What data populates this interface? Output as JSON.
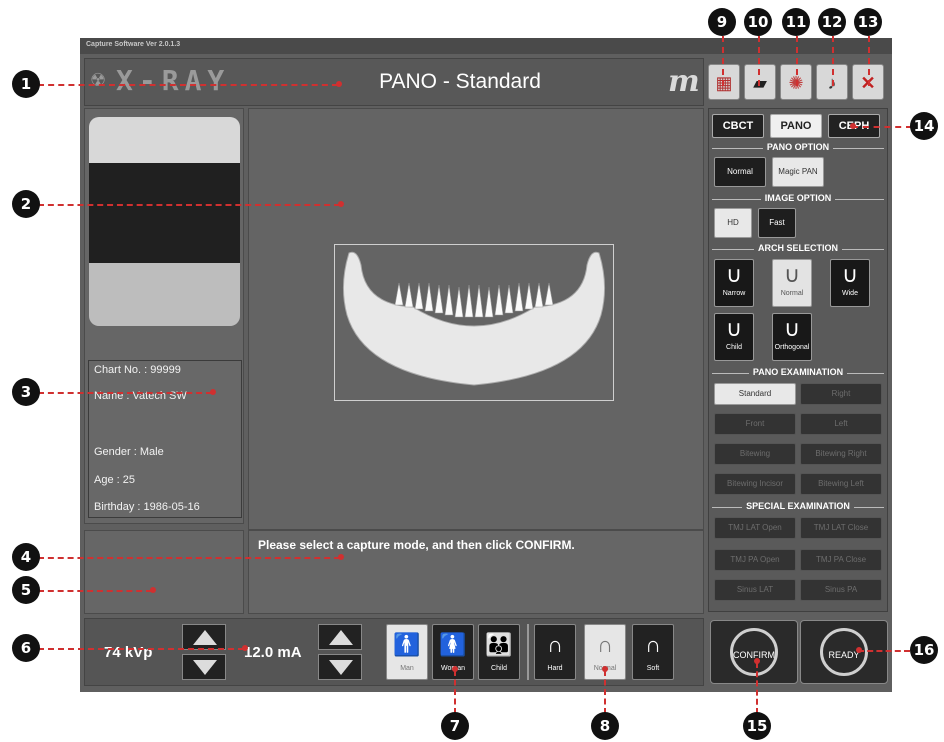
{
  "app": {
    "title_bar": "Capture Software Ver 2.0.1.3",
    "logo_text": "X-RAY",
    "mode_title": "PANO - Standard",
    "brand_mark": "m"
  },
  "toolbar": [
    {
      "name": "image-tool",
      "callout": "9"
    },
    {
      "name": "folder",
      "callout": "10"
    },
    {
      "name": "light",
      "callout": "11"
    },
    {
      "name": "settings",
      "callout": "12"
    },
    {
      "name": "exit",
      "callout": "13"
    }
  ],
  "modality_tabs": [
    {
      "label": "CBCT",
      "selected": false
    },
    {
      "label": "PANO",
      "selected": true
    },
    {
      "label": "CEPH",
      "selected": false
    }
  ],
  "pano_option": {
    "title": "PANO OPTION",
    "items": [
      {
        "label": "Normal",
        "selected": false
      },
      {
        "label": "Magic PAN",
        "selected": true
      }
    ]
  },
  "image_option": {
    "title": "IMAGE OPTION",
    "items": [
      {
        "label": "HD",
        "selected": true
      },
      {
        "label": "Fast",
        "selected": false
      }
    ]
  },
  "arch_selection": {
    "title": "ARCH SELECTION",
    "items": [
      {
        "label": "Narrow",
        "selected": false
      },
      {
        "label": "Normal",
        "selected": true
      },
      {
        "label": "Wide",
        "selected": false
      },
      {
        "label": "Child",
        "selected": false
      },
      {
        "label": "Orthogonal",
        "selected": false
      }
    ]
  },
  "pano_examination": {
    "title": "PANO EXAMINATION",
    "items": [
      {
        "label": "Standard",
        "state": "selected"
      },
      {
        "label": "Right",
        "state": "disabled"
      },
      {
        "label": "Front",
        "state": "disabled"
      },
      {
        "label": "Left",
        "state": "disabled"
      },
      {
        "label": "Bitewing",
        "state": "disabled"
      },
      {
        "label": "Bitewing Right",
        "state": "disabled"
      },
      {
        "label": "Bitewing Incisor",
        "state": "disabled"
      },
      {
        "label": "Bitewing Left",
        "state": "disabled"
      }
    ]
  },
  "special_examination": {
    "title": "SPECIAL EXAMINATION",
    "items": [
      {
        "label": "TMJ LAT Open"
      },
      {
        "label": "TMJ LAT Close"
      },
      {
        "label": "TMJ PA Open"
      },
      {
        "label": "TMJ PA Close"
      },
      {
        "label": "Sinus LAT"
      },
      {
        "label": "Sinus PA"
      }
    ]
  },
  "patient": {
    "chart": "Chart No. : 99999",
    "name": "Name : Vatech SW",
    "gender": "Gender : Male",
    "age": "Age : 25",
    "birthday": "Birthday : 1986-05-16"
  },
  "message": "Please select a capture mode, and then click CONFIRM.",
  "exposure": {
    "kvp": "74 kVp",
    "ma": "12.0 mA"
  },
  "patient_type": [
    {
      "label": "Man",
      "selected": true
    },
    {
      "label": "Woman",
      "selected": false
    },
    {
      "label": "Child",
      "selected": false
    }
  ],
  "bone_density": [
    {
      "label": "Hard",
      "selected": false
    },
    {
      "label": "Normal",
      "selected": true
    },
    {
      "label": "Soft",
      "selected": false
    }
  ],
  "actions": {
    "confirm": "CONFIRM",
    "ready": "READY"
  },
  "callouts": [
    "1",
    "2",
    "3",
    "4",
    "5",
    "6",
    "7",
    "8",
    "9",
    "10",
    "11",
    "12",
    "13",
    "14",
    "15",
    "16"
  ],
  "colors": {
    "callout_line": "#d03030",
    "panel": "#5f5f5f",
    "selected": "#e8e8e8"
  }
}
